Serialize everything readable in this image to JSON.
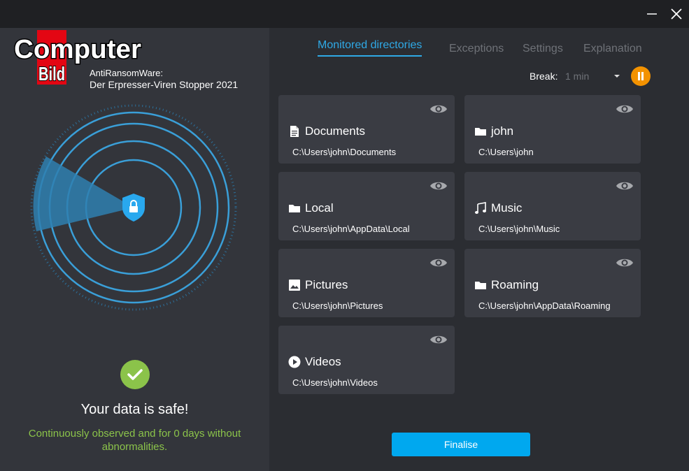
{
  "window": {
    "minimize_icon": "minimize-icon",
    "close_icon": "close-icon"
  },
  "brand": {
    "logo_text_top": "Computer",
    "logo_text_bottom": "Bild",
    "app_name_line1": "AntiRansomWare:",
    "app_name_line2": "Der Erpresser-Viren Stopper 2021",
    "logo_red": "#e30613"
  },
  "status": {
    "title": "Your data is safe!",
    "subtitle": "Continuously observed and for 0 days without abnormalities.",
    "ok_color": "#8bc34a"
  },
  "tabs": [
    {
      "label": "Monitored directories",
      "active": true
    },
    {
      "label": "Exceptions",
      "active": false
    },
    {
      "label": "Settings",
      "active": false
    },
    {
      "label": "Explanation",
      "active": false
    }
  ],
  "break": {
    "label": "Break:",
    "value": "1 min",
    "pause_color": "#f39200"
  },
  "directories": [
    {
      "name": "Documents",
      "path": "C:\\Users\\john\\Documents",
      "icon": "document-icon"
    },
    {
      "name": "john",
      "path": "C:\\Users\\john",
      "icon": "folder-icon"
    },
    {
      "name": "Local",
      "path": "C:\\Users\\john\\AppData\\Local",
      "icon": "folder-icon"
    },
    {
      "name": "Music",
      "path": "C:\\Users\\john\\Music",
      "icon": "music-icon"
    },
    {
      "name": "Pictures",
      "path": "C:\\Users\\john\\Pictures",
      "icon": "image-icon"
    },
    {
      "name": "Roaming",
      "path": "C:\\Users\\john\\AppData\\Roaming",
      "icon": "folder-icon"
    },
    {
      "name": "Videos",
      "path": "C:\\Users\\john\\Videos",
      "icon": "play-icon"
    }
  ],
  "actions": {
    "finalise_label": "Finalise",
    "accent": "#00a8ef"
  }
}
